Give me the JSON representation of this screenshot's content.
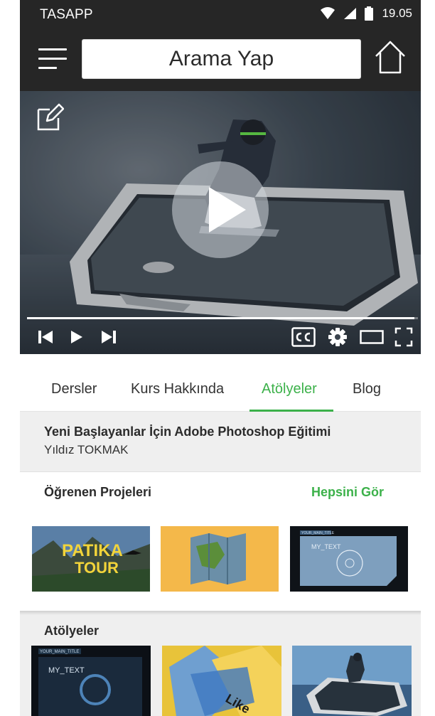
{
  "status_bar": {
    "carrier": "TASAPP",
    "time": "19.05"
  },
  "top_bar": {
    "search_label": "Arama Yap"
  },
  "video": {
    "progress_fraction": 0.99
  },
  "tabs": [
    {
      "label": "Dersler",
      "active": false
    },
    {
      "label": "Kurs Hakkında",
      "active": false
    },
    {
      "label": "Atölyeler",
      "active": true
    },
    {
      "label": "Blog",
      "active": false
    }
  ],
  "course": {
    "title": "Yeni Başlayanlar İçin Adobe Photoshop Eğitimi",
    "author": "Yıldız TOKMAK"
  },
  "student_projects": {
    "heading": "Öğrenen Projeleri",
    "see_all": "Hepsini Gör",
    "thumbs": [
      {
        "text_line1": "PATIKA",
        "text_line2": "TOUR"
      },
      {
        "text_line1": "",
        "text_line2": ""
      },
      {
        "text_line1": "YOUR_MAIN_TITLE",
        "text_line2": "MY_TEXT"
      }
    ]
  },
  "workshops": {
    "heading": "Atölyeler",
    "thumbs": [
      {
        "text_line1": "YOUR_MAIN_TITLE",
        "text_line2": "MY_TEXT"
      },
      {
        "text_line1": "Like",
        "text_line2": ""
      },
      {
        "text_line1": "",
        "text_line2": ""
      }
    ]
  },
  "colors": {
    "accent": "#3cb14a",
    "bar": "#262626",
    "panel": "#efefef"
  }
}
